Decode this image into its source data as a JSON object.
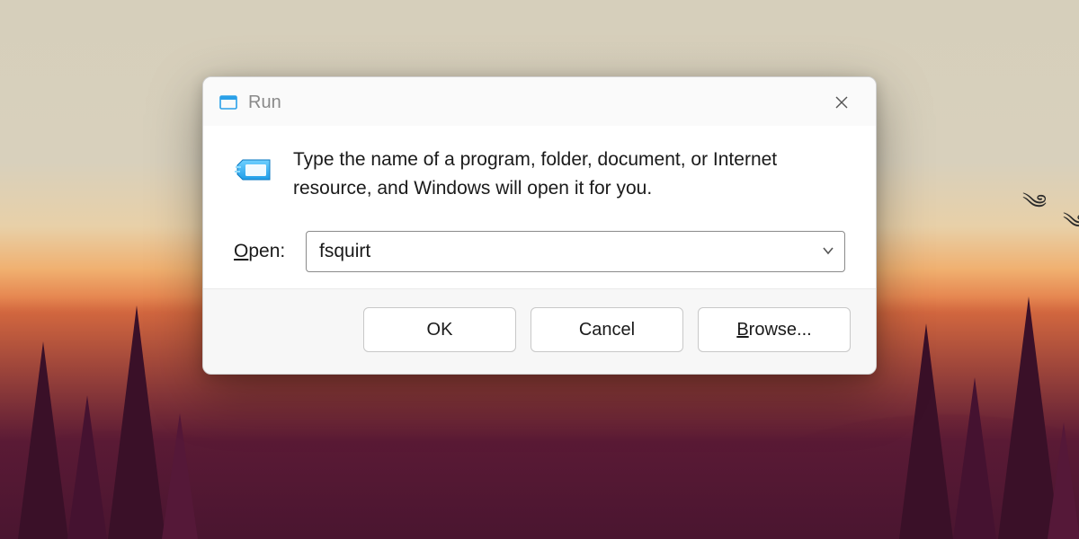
{
  "dialog": {
    "title": "Run",
    "description": "Type the name of a program, folder, document, or Internet resource, and Windows will open it for you.",
    "open_label_u": "O",
    "open_label_rest": "pen:",
    "input_value": "fsquirt",
    "buttons": {
      "ok": "OK",
      "cancel": "Cancel",
      "browse_u": "B",
      "browse_rest": "rowse..."
    }
  },
  "icons": {
    "title": "run-window-icon",
    "body": "run-program-icon",
    "close": "close-icon",
    "chevron": "chevron-down-icon"
  }
}
